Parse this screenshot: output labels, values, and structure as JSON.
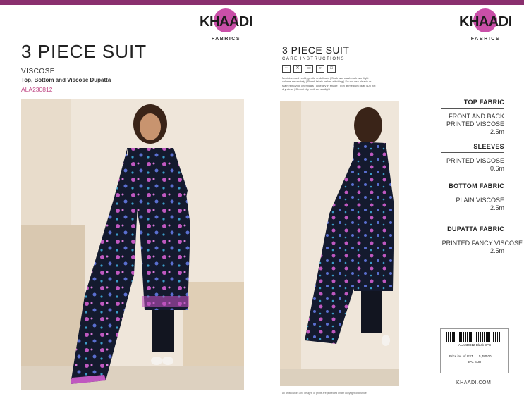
{
  "brand": {
    "logo": "KHAADI",
    "sub": "FABRICS",
    "website": "KHAADI.COM",
    "color": "#8a2f6e"
  },
  "left": {
    "title": "3 PIECE SUIT",
    "fabric": "VISCOSE",
    "description": "Top, Bottom and Viscose  Dupatta",
    "code": "ALA230812"
  },
  "middle": {
    "title": "3 PIECE SUIT",
    "care_heading": "CARE INSTRUCTIONS",
    "care_icons": [
      "wash-icon",
      "no-bleach-icon",
      "iron-icon",
      "dry-clean-icon",
      "tumble-icon"
    ],
    "care_text": "Machine wash cold, gentle or delicate | Soak and wash dark and light colours separately | Shrink fabric before stitching | Do not use bleach or stain removing chemicals | Line dry in shade | Iron at medium heat | Do not dry clean | Do not dry in direct sunlight",
    "copyright": "All artistic work and designs of prints are protected under copyright ordinance"
  },
  "specs": [
    {
      "heading": "TOP FABRIC",
      "lines": [
        "FRONT AND BACK",
        "PRINTED VISCOSE",
        "2.5m"
      ]
    },
    {
      "heading": "SLEEVES",
      "lines": [
        "PRINTED VISCOSE",
        "0.6m"
      ]
    },
    {
      "heading": "BOTTOM FABRIC",
      "lines": [
        "PLAIN VISCOSE",
        "2.5m"
      ]
    },
    {
      "heading": "DUPATTA FABRIC",
      "lines": [
        "PRINTED FANCY VISCOSE",
        "2.5m"
      ]
    }
  ],
  "tag": {
    "sku": "ALA230812-Black-3PC",
    "price_label": "Price inc. of GST",
    "price": "5,480.00",
    "type": "3PC SUIT"
  }
}
